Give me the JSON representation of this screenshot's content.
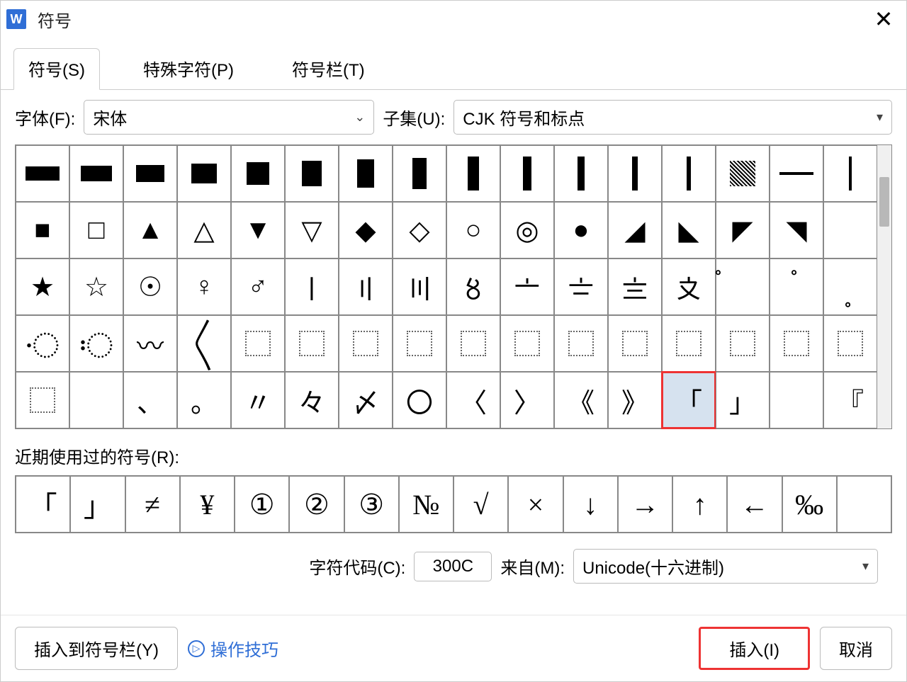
{
  "window": {
    "title": "符号"
  },
  "tabs": [
    {
      "label": "符号(S)",
      "active": true
    },
    {
      "label": "特殊字符(P)",
      "active": false
    },
    {
      "label": "符号栏(T)",
      "active": false
    }
  ],
  "font": {
    "label": "字体(F):",
    "value": "宋体"
  },
  "subset": {
    "label": "子集(U):",
    "value": "CJK 符号和标点"
  },
  "grid": [
    [
      "▬",
      "▬",
      "▬",
      "█",
      "█",
      "█",
      "▮",
      "▮",
      "▮",
      "▮",
      "▮",
      "▮",
      "▮",
      "▒",
      "▔",
      "▕"
    ],
    [
      "■",
      "□",
      "▲",
      "△",
      "▼",
      "▽",
      "◆",
      "◇",
      "○",
      "◎",
      "●",
      "◢",
      "◣",
      "◤",
      "◥",
      ""
    ],
    [
      "★",
      "☆",
      "☉",
      "♀",
      "♂",
      "〡",
      "〢",
      "〣",
      "〥",
      "〦",
      "〧",
      "〨",
      "〩",
      "〫",
      "〬",
      "〭"
    ],
    [
      "〮",
      "〯",
      "〰",
      "〱",
      "▢",
      "▢",
      "▢",
      "▢",
      "▢",
      "▢",
      "▢",
      "▢",
      "▢",
      "▢",
      "▢",
      "▢"
    ],
    [
      "▢",
      "",
      "、",
      "。",
      "〃",
      "々",
      "〆",
      "〇",
      "〈",
      "〉",
      "《",
      "》",
      "「",
      "」",
      "",
      "『"
    ]
  ],
  "selected": {
    "row": 4,
    "col": 12
  },
  "recent": {
    "label": "近期使用过的符号(R):",
    "items": [
      "「",
      "」",
      "≠",
      "¥",
      "①",
      "②",
      "③",
      "№",
      "√",
      "×",
      "↓",
      "→",
      "↑",
      "←",
      "‰",
      ""
    ]
  },
  "code": {
    "label": "字符代码(C):",
    "value": "300C"
  },
  "from": {
    "label": "来自(M):",
    "value": "Unicode(十六进制)"
  },
  "footer": {
    "insert_to_bar": "插入到符号栏(Y)",
    "tips": "操作技巧",
    "insert": "插入(I)",
    "cancel": "取消"
  }
}
